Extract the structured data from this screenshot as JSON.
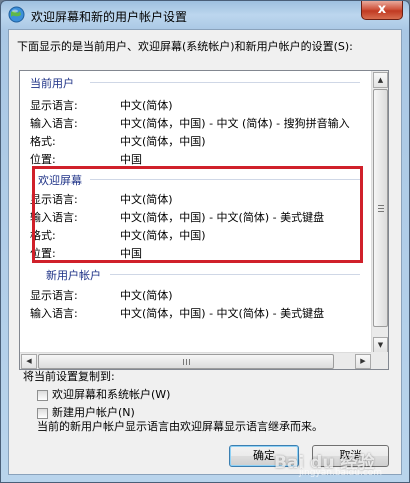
{
  "window": {
    "title": "欢迎屏幕和新的用户帐户设置",
    "close_label": "x"
  },
  "description": "下面显示的是当前用户、欢迎屏幕(系统帐户)和新用户帐户的设置(S):",
  "sections": {
    "current_user": {
      "heading": "当前用户",
      "rows": [
        {
          "label": "显示语言:",
          "value": "中文(简体)"
        },
        {
          "label": "输入语言:",
          "value": "中文(简体，中国) - 中文 (简体) - 搜狗拼音输入"
        },
        {
          "label": "格式:",
          "value": "中文(简体，中国)"
        },
        {
          "label": "位置:",
          "value": "中国"
        }
      ]
    },
    "welcome_screen": {
      "heading": "欢迎屏幕",
      "rows": [
        {
          "label": "显示语言:",
          "value": "中文(简体)"
        },
        {
          "label": "输入语言:",
          "value": "中文(简体，中国) - 中文(简体) - 美式键盘"
        },
        {
          "label": "格式:",
          "value": "中文(简体，中国)"
        },
        {
          "label": "位置:",
          "value": "中国"
        }
      ]
    },
    "new_user": {
      "heading": "新用户帐户",
      "rows": [
        {
          "label": "显示语言:",
          "value": "中文(简体)"
        },
        {
          "label": "输入语言:",
          "value": "中文(简体，中国) - 中文(简体) - 美式键盘"
        }
      ]
    }
  },
  "copy_section": {
    "label": "将当前设置复制到:",
    "options": [
      {
        "label": "欢迎屏幕和系统帐户(W)",
        "checked": false
      },
      {
        "label": "新建用户帐户(N)",
        "checked": false
      }
    ],
    "note": "当前的新用户帐户显示语言由欢迎屏幕显示语言继承而来。"
  },
  "buttons": {
    "ok": "确定",
    "cancel": "取消"
  },
  "watermark": {
    "text": "Bai du 经验",
    "sub": "jingyan.baidu.com"
  },
  "colors": {
    "highlight_border": "#d0202a",
    "section_heading": "#1e3287"
  }
}
